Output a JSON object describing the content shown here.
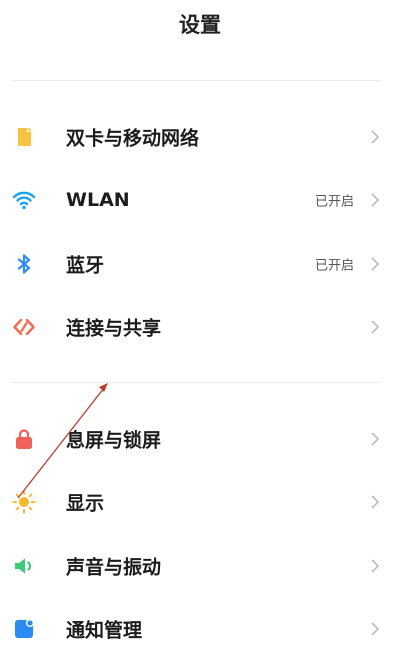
{
  "header": {
    "title": "设置"
  },
  "colors": {
    "sim_icon": "#F6C343",
    "wlan_icon": "#1AA3F0",
    "bluetooth_icon": "#2A8CF0",
    "share_icon": "#F26B4F",
    "lock_icon": "#F2605A",
    "display_icon": "#F6B92E",
    "sound_icon": "#3DCB7A",
    "notify_icon": "#2A8CF0",
    "chevron": "#b5b5b5",
    "annotation_arrow": "#c0392b"
  },
  "sections": [
    {
      "items": [
        {
          "label": "双卡与移动网络",
          "status": "",
          "icon": "sim-card-icon"
        },
        {
          "label": "WLAN",
          "status": "已开启",
          "icon": "wifi-icon"
        },
        {
          "label": "蓝牙",
          "status": "已开启",
          "icon": "bluetooth-icon"
        },
        {
          "label": "连接与共享",
          "status": "",
          "icon": "connection-share-icon"
        }
      ]
    },
    {
      "items": [
        {
          "label": "息屏与锁屏",
          "status": "",
          "icon": "lock-icon"
        },
        {
          "label": "显示",
          "status": "",
          "icon": "sun-icon"
        },
        {
          "label": "声音与振动",
          "status": "",
          "icon": "speaker-icon"
        },
        {
          "label": "通知管理",
          "status": "",
          "icon": "notification-icon"
        }
      ]
    }
  ]
}
